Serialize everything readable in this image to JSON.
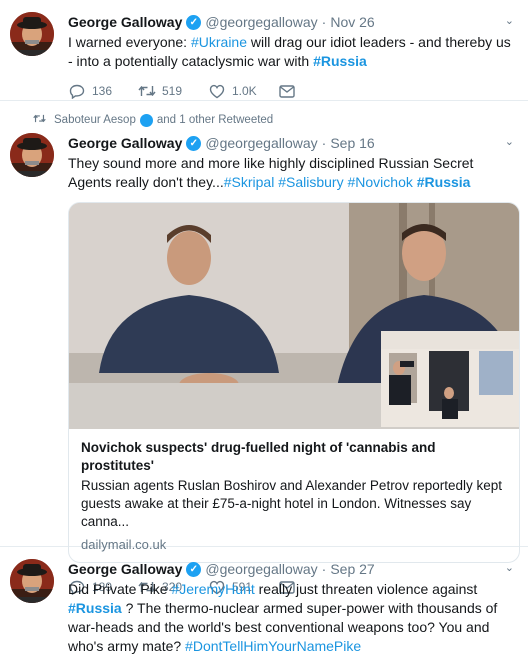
{
  "tweets": [
    {
      "name": "George Galloway",
      "handle": "@georgegalloway",
      "date": "Nov 26",
      "text_parts": [
        {
          "t": "I warned everyone: ",
          "type": "plain"
        },
        {
          "t": "#Ukraine",
          "type": "tag"
        },
        {
          "t": " will drag our idiot leaders - and thereby us - into a potentially cataclysmic war with ",
          "type": "plain"
        },
        {
          "t": "#Russia",
          "type": "tagbold"
        }
      ],
      "replies": "136",
      "retweets": "519",
      "likes": "1.0K"
    },
    {
      "retweet_context": {
        "user": "Saboteur Aesop",
        "suffix": "and 1 other Retweeted"
      },
      "name": "George Galloway",
      "handle": "@georgegalloway",
      "date": "Sep 16",
      "text_parts": [
        {
          "t": "They sound more and more like highly disciplined Russian Secret Agents really don't they...",
          "type": "plain"
        },
        {
          "t": "#Skripal",
          "type": "tag"
        },
        {
          "t": " ",
          "type": "plain"
        },
        {
          "t": "#Salisbury",
          "type": "tag"
        },
        {
          "t": " ",
          "type": "plain"
        },
        {
          "t": "#Novichok",
          "type": "tag"
        },
        {
          "t": " ",
          "type": "plain"
        },
        {
          "t": "#Russia",
          "type": "tagbold"
        }
      ],
      "card": {
        "title": "Novichok suspects' drug-fuelled night of 'cannabis and prostitutes'",
        "description": "Russian agents Ruslan Boshirov and Alexander Petrov reportedly kept guests awake at their £75-a-night hotel in London. Witnesses say canna...",
        "domain": "dailymail.co.uk"
      },
      "replies": "189",
      "retweets": "320",
      "likes": "591"
    },
    {
      "name": "George Galloway",
      "handle": "@georgegalloway",
      "date": "Sep 27",
      "text_parts": [
        {
          "t": "Did Private Pike ",
          "type": "plain"
        },
        {
          "t": "#JeremyHunt",
          "type": "tag"
        },
        {
          "t": " really just threaten violence against ",
          "type": "plain"
        },
        {
          "t": "#Russia",
          "type": "tagbold"
        },
        {
          "t": " ? The thermo-nuclear armed super-power with thousands of war-heads and the world's best conventional weapons too? You and who's army mate? ",
          "type": "plain"
        },
        {
          "t": "#DontTellHimYourNamePike",
          "type": "tag"
        }
      ]
    }
  ],
  "colors": {
    "link": "#1b95e0",
    "muted": "#657786",
    "verified": "#1da1f2"
  }
}
